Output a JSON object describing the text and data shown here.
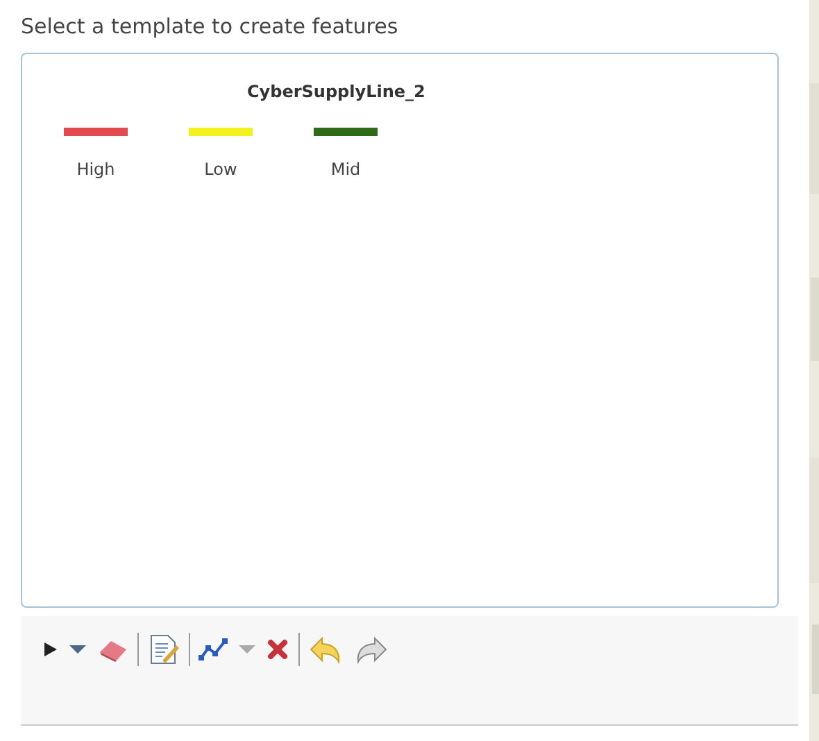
{
  "prompt": "Select a template to create features",
  "layer": {
    "name": "CyberSupplyLine_2",
    "templates": [
      {
        "label": "High",
        "color": "#e34a4f"
      },
      {
        "label": "Low",
        "color": "#f4f21e"
      },
      {
        "label": "Mid",
        "color": "#2f6b16"
      }
    ]
  }
}
